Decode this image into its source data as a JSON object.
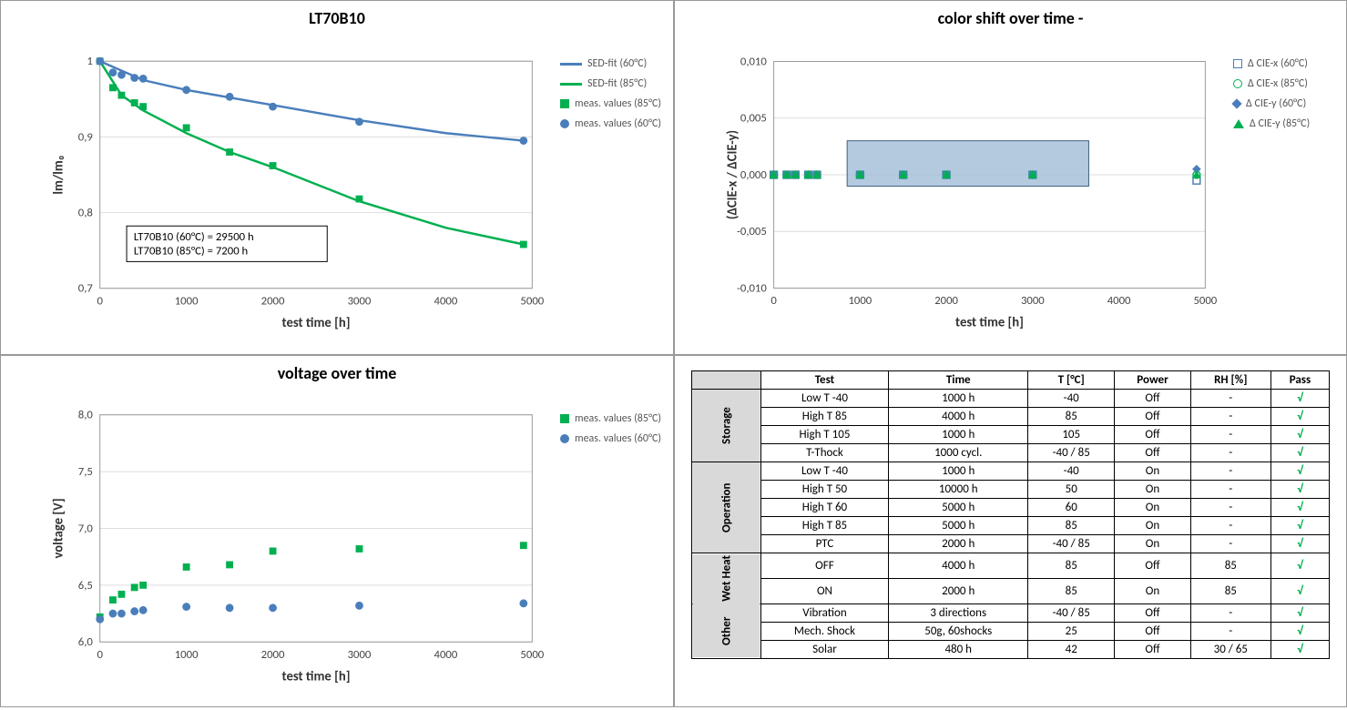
{
  "chart_data": [
    {
      "id": "lumen",
      "type": "scatter",
      "title": "LT70B10",
      "xlabel": "test time [h]",
      "ylabel": "lm/lm₀",
      "xlim": [
        0,
        5000
      ],
      "ylim": [
        0.7,
        1.0
      ],
      "xticks": [
        0,
        1000,
        2000,
        3000,
        4000,
        5000
      ],
      "yticks": [
        0.7,
        0.8,
        0.9,
        1.0
      ],
      "ytick_labels": [
        "0,7",
        "0,8",
        "0,9",
        "1"
      ],
      "series": [
        {
          "name": "SED-fit (60°C)",
          "type": "line",
          "color": "#4a7ebb",
          "x": [
            0,
            500,
            1000,
            1500,
            2000,
            3000,
            4000,
            4900
          ],
          "y": [
            1.0,
            0.975,
            0.962,
            0.952,
            0.942,
            0.922,
            0.905,
            0.895
          ]
        },
        {
          "name": "SED-fit (85°C)",
          "type": "line",
          "color": "#00b050",
          "x": [
            0,
            250,
            500,
            1000,
            1500,
            2000,
            3000,
            4000,
            4900
          ],
          "y": [
            1.0,
            0.955,
            0.935,
            0.905,
            0.88,
            0.86,
            0.815,
            0.78,
            0.758
          ]
        },
        {
          "name": "meas. values (85°C)",
          "type": "marker",
          "shape": "square",
          "color": "#00b050",
          "x": [
            0,
            150,
            250,
            400,
            500,
            1000,
            1500,
            2000,
            3000,
            4900
          ],
          "y": [
            1.0,
            0.965,
            0.955,
            0.945,
            0.94,
            0.912,
            0.88,
            0.862,
            0.818,
            0.758
          ]
        },
        {
          "name": "meas. values (60°C)",
          "type": "marker",
          "shape": "circle",
          "color": "#4a7ebb",
          "x": [
            0,
            150,
            250,
            400,
            500,
            1000,
            1500,
            2000,
            3000,
            4900
          ],
          "y": [
            1.0,
            0.985,
            0.982,
            0.978,
            0.977,
            0.962,
            0.953,
            0.94,
            0.92,
            0.895
          ]
        }
      ],
      "annotation": {
        "lines": [
          "LT70B10 (60°C) = 29500 h",
          "LT70B10 (85°C) =   7200 h"
        ]
      }
    },
    {
      "id": "colorshift",
      "type": "scatter",
      "title": "color shift over time -",
      "xlabel": "test time [h]",
      "ylabel": "(ΔCIE-x / ΔCIE-y)",
      "xlim": [
        0,
        5000
      ],
      "ylim": [
        -0.01,
        0.01
      ],
      "xticks": [
        0,
        1000,
        2000,
        3000,
        4000,
        5000
      ],
      "yticks": [
        -0.01,
        -0.005,
        0.0,
        0.005,
        0.01
      ],
      "ytick_labels": [
        "-0,010",
        "-0,005",
        "0,000",
        "0,005",
        "0,010"
      ],
      "shaded_box": {
        "x0": 850,
        "x1": 3650,
        "y0": -0.001,
        "y1": 0.003
      },
      "series": [
        {
          "name": "Δ CIE-x (60°C)",
          "type": "marker",
          "shape": "square-open",
          "color": "#4a7ebb",
          "x": [
            0,
            150,
            250,
            400,
            500,
            1000,
            1500,
            2000,
            3000,
            4900
          ],
          "y": [
            0,
            0,
            0,
            0,
            0,
            0,
            0,
            0,
            0,
            -0.0005
          ]
        },
        {
          "name": "Δ CIE-x (85°C)",
          "type": "marker",
          "shape": "circle-open",
          "color": "#00b050",
          "x": [
            0,
            150,
            250,
            400,
            500,
            1000,
            1500,
            2000,
            3000,
            4900
          ],
          "y": [
            0,
            0,
            0,
            0,
            0,
            0,
            0,
            0,
            0,
            0
          ]
        },
        {
          "name": "Δ CIE-y (60°C)",
          "type": "marker",
          "shape": "diamond",
          "color": "#4a7ebb",
          "x": [
            0,
            150,
            250,
            400,
            500,
            1000,
            1500,
            2000,
            3000,
            4900
          ],
          "y": [
            0,
            0,
            0,
            0,
            0,
            0,
            0,
            0,
            0,
            0.0005
          ]
        },
        {
          "name": "Δ CIE-y (85°C)",
          "type": "marker",
          "shape": "triangle",
          "color": "#00b050",
          "x": [
            0,
            150,
            250,
            400,
            500,
            1000,
            1500,
            2000,
            3000,
            4900
          ],
          "y": [
            0,
            0,
            0,
            0,
            0,
            0,
            0,
            0,
            0,
            0
          ]
        }
      ]
    },
    {
      "id": "voltage",
      "type": "scatter",
      "title": "voltage over time",
      "xlabel": "test time [h]",
      "ylabel": "voltage [V]",
      "xlim": [
        0,
        5000
      ],
      "ylim": [
        6.0,
        8.0
      ],
      "xticks": [
        0,
        1000,
        2000,
        3000,
        4000,
        5000
      ],
      "yticks": [
        6.0,
        6.5,
        7.0,
        7.5,
        8.0
      ],
      "ytick_labels": [
        "6,0",
        "6,5",
        "7,0",
        "7,5",
        "8,0"
      ],
      "series": [
        {
          "name": "meas. values (85°C)",
          "type": "marker",
          "shape": "square",
          "color": "#00b050",
          "x": [
            0,
            150,
            250,
            400,
            500,
            1000,
            1500,
            2000,
            3000,
            4900
          ],
          "y": [
            6.22,
            6.37,
            6.42,
            6.48,
            6.5,
            6.66,
            6.68,
            6.8,
            6.82,
            6.85
          ]
        },
        {
          "name": "meas. values (60°C)",
          "type": "marker",
          "shape": "circle",
          "color": "#4a7ebb",
          "x": [
            0,
            150,
            250,
            400,
            500,
            1000,
            1500,
            2000,
            3000,
            4900
          ],
          "y": [
            6.2,
            6.25,
            6.25,
            6.27,
            6.28,
            6.31,
            6.3,
            6.3,
            6.32,
            6.34
          ]
        }
      ]
    }
  ],
  "legend": {
    "lumen": [
      {
        "label": "SED-fit (60°C)",
        "kind": "line",
        "color": "#4a7ebb"
      },
      {
        "label": "SED-fit (85°C)",
        "kind": "line",
        "color": "#00b050"
      },
      {
        "label": "meas. values (85°C)",
        "kind": "square",
        "color": "#00b050"
      },
      {
        "label": "meas. values (60°C)",
        "kind": "circle",
        "color": "#4a7ebb"
      }
    ],
    "colorshift": [
      {
        "label": "Δ CIE-x (60°C)",
        "kind": "square-open",
        "color": "#4a7ebb"
      },
      {
        "label": "Δ CIE-x (85°C)",
        "kind": "circle-open",
        "color": "#00b050"
      },
      {
        "label": "Δ CIE-y (60°C)",
        "kind": "diamond",
        "color": "#4a7ebb"
      },
      {
        "label": "Δ CIE-y (85°C)",
        "kind": "triangle",
        "color": "#00b050"
      }
    ],
    "voltage": [
      {
        "label": "meas. values (85°C)",
        "kind": "square",
        "color": "#00b050"
      },
      {
        "label": "meas. values (60°C)",
        "kind": "circle",
        "color": "#4a7ebb"
      }
    ]
  },
  "table": {
    "headers": [
      "Test",
      "Time",
      "T [°C]",
      "Power",
      "RH [%]",
      "Pass"
    ],
    "groups": [
      {
        "name": "Storage",
        "rows": [
          [
            "Low T -40",
            "1000 h",
            "-40",
            "Off",
            "-",
            "√"
          ],
          [
            "High T 85",
            "4000 h",
            "85",
            "Off",
            "-",
            "√"
          ],
          [
            "High T 105",
            "1000 h",
            "105",
            "Off",
            "-",
            "√"
          ],
          [
            "T-Thock",
            "1000 cycl.",
            "-40 / 85",
            "Off",
            "-",
            "√"
          ]
        ]
      },
      {
        "name": "Operation",
        "rows": [
          [
            "Low T -40",
            "1000 h",
            "-40",
            "On",
            "-",
            "√"
          ],
          [
            "High T 50",
            "10000 h",
            "50",
            "On",
            "-",
            "√"
          ],
          [
            "High T 60",
            "5000 h",
            "60",
            "On",
            "-",
            "√"
          ],
          [
            "High T 85",
            "5000 h",
            "85",
            "On",
            "-",
            "√"
          ],
          [
            "PTC",
            "2000 h",
            "-40 / 85",
            "On",
            "-",
            "√"
          ]
        ]
      },
      {
        "name": "Wet Heat",
        "rows": [
          [
            "OFF",
            "4000 h",
            "85",
            "Off",
            "85",
            "√"
          ],
          [
            "ON",
            "2000 h",
            "85",
            "On",
            "85",
            "√"
          ]
        ]
      },
      {
        "name": "Other",
        "rows": [
          [
            "Vibration",
            "3 directions",
            "-40 / 85",
            "Off",
            "-",
            "√"
          ],
          [
            "Mech. Shock",
            "50g, 60shocks",
            "25",
            "Off",
            "-",
            "√"
          ],
          [
            "Solar",
            "480 h",
            "42",
            "Off",
            "30 / 65",
            "√"
          ]
        ]
      }
    ]
  }
}
